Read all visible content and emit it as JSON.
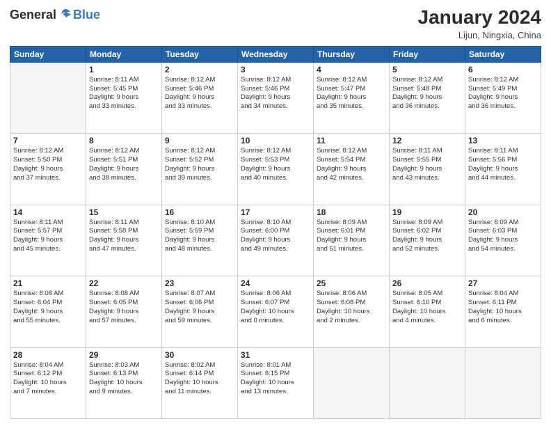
{
  "header": {
    "logo_general": "General",
    "logo_blue": "Blue",
    "title": "January 2024",
    "subtitle": "Lijun, Ningxia, China"
  },
  "columns": [
    "Sunday",
    "Monday",
    "Tuesday",
    "Wednesday",
    "Thursday",
    "Friday",
    "Saturday"
  ],
  "weeks": [
    [
      {
        "num": "",
        "info": ""
      },
      {
        "num": "1",
        "info": "Sunrise: 8:11 AM\nSunset: 5:45 PM\nDaylight: 9 hours\nand 33 minutes."
      },
      {
        "num": "2",
        "info": "Sunrise: 8:12 AM\nSunset: 5:46 PM\nDaylight: 9 hours\nand 33 minutes."
      },
      {
        "num": "3",
        "info": "Sunrise: 8:12 AM\nSunset: 5:46 PM\nDaylight: 9 hours\nand 34 minutes."
      },
      {
        "num": "4",
        "info": "Sunrise: 8:12 AM\nSunset: 5:47 PM\nDaylight: 9 hours\nand 35 minutes."
      },
      {
        "num": "5",
        "info": "Sunrise: 8:12 AM\nSunset: 5:48 PM\nDaylight: 9 hours\nand 36 minutes."
      },
      {
        "num": "6",
        "info": "Sunrise: 8:12 AM\nSunset: 5:49 PM\nDaylight: 9 hours\nand 36 minutes."
      }
    ],
    [
      {
        "num": "7",
        "info": "Sunrise: 8:12 AM\nSunset: 5:50 PM\nDaylight: 9 hours\nand 37 minutes."
      },
      {
        "num": "8",
        "info": "Sunrise: 8:12 AM\nSunset: 5:51 PM\nDaylight: 9 hours\nand 38 minutes."
      },
      {
        "num": "9",
        "info": "Sunrise: 8:12 AM\nSunset: 5:52 PM\nDaylight: 9 hours\nand 39 minutes."
      },
      {
        "num": "10",
        "info": "Sunrise: 8:12 AM\nSunset: 5:53 PM\nDaylight: 9 hours\nand 40 minutes."
      },
      {
        "num": "11",
        "info": "Sunrise: 8:12 AM\nSunset: 5:54 PM\nDaylight: 9 hours\nand 42 minutes."
      },
      {
        "num": "12",
        "info": "Sunrise: 8:11 AM\nSunset: 5:55 PM\nDaylight: 9 hours\nand 43 minutes."
      },
      {
        "num": "13",
        "info": "Sunrise: 8:11 AM\nSunset: 5:56 PM\nDaylight: 9 hours\nand 44 minutes."
      }
    ],
    [
      {
        "num": "14",
        "info": "Sunrise: 8:11 AM\nSunset: 5:57 PM\nDaylight: 9 hours\nand 45 minutes."
      },
      {
        "num": "15",
        "info": "Sunrise: 8:11 AM\nSunset: 5:58 PM\nDaylight: 9 hours\nand 47 minutes."
      },
      {
        "num": "16",
        "info": "Sunrise: 8:10 AM\nSunset: 5:59 PM\nDaylight: 9 hours\nand 48 minutes."
      },
      {
        "num": "17",
        "info": "Sunrise: 8:10 AM\nSunset: 6:00 PM\nDaylight: 9 hours\nand 49 minutes."
      },
      {
        "num": "18",
        "info": "Sunrise: 8:09 AM\nSunset: 6:01 PM\nDaylight: 9 hours\nand 51 minutes."
      },
      {
        "num": "19",
        "info": "Sunrise: 8:09 AM\nSunset: 6:02 PM\nDaylight: 9 hours\nand 52 minutes."
      },
      {
        "num": "20",
        "info": "Sunrise: 8:09 AM\nSunset: 6:03 PM\nDaylight: 9 hours\nand 54 minutes."
      }
    ],
    [
      {
        "num": "21",
        "info": "Sunrise: 8:08 AM\nSunset: 6:04 PM\nDaylight: 9 hours\nand 55 minutes."
      },
      {
        "num": "22",
        "info": "Sunrise: 8:08 AM\nSunset: 6:05 PM\nDaylight: 9 hours\nand 57 minutes."
      },
      {
        "num": "23",
        "info": "Sunrise: 8:07 AM\nSunset: 6:06 PM\nDaylight: 9 hours\nand 59 minutes."
      },
      {
        "num": "24",
        "info": "Sunrise: 8:06 AM\nSunset: 6:07 PM\nDaylight: 10 hours\nand 0 minutes."
      },
      {
        "num": "25",
        "info": "Sunrise: 8:06 AM\nSunset: 6:08 PM\nDaylight: 10 hours\nand 2 minutes."
      },
      {
        "num": "26",
        "info": "Sunrise: 8:05 AM\nSunset: 6:10 PM\nDaylight: 10 hours\nand 4 minutes."
      },
      {
        "num": "27",
        "info": "Sunrise: 8:04 AM\nSunset: 6:11 PM\nDaylight: 10 hours\nand 6 minutes."
      }
    ],
    [
      {
        "num": "28",
        "info": "Sunrise: 8:04 AM\nSunset: 6:12 PM\nDaylight: 10 hours\nand 7 minutes."
      },
      {
        "num": "29",
        "info": "Sunrise: 8:03 AM\nSunset: 6:13 PM\nDaylight: 10 hours\nand 9 minutes."
      },
      {
        "num": "30",
        "info": "Sunrise: 8:02 AM\nSunset: 6:14 PM\nDaylight: 10 hours\nand 11 minutes."
      },
      {
        "num": "31",
        "info": "Sunrise: 8:01 AM\nSunset: 6:15 PM\nDaylight: 10 hours\nand 13 minutes."
      },
      {
        "num": "",
        "info": ""
      },
      {
        "num": "",
        "info": ""
      },
      {
        "num": "",
        "info": ""
      }
    ]
  ]
}
